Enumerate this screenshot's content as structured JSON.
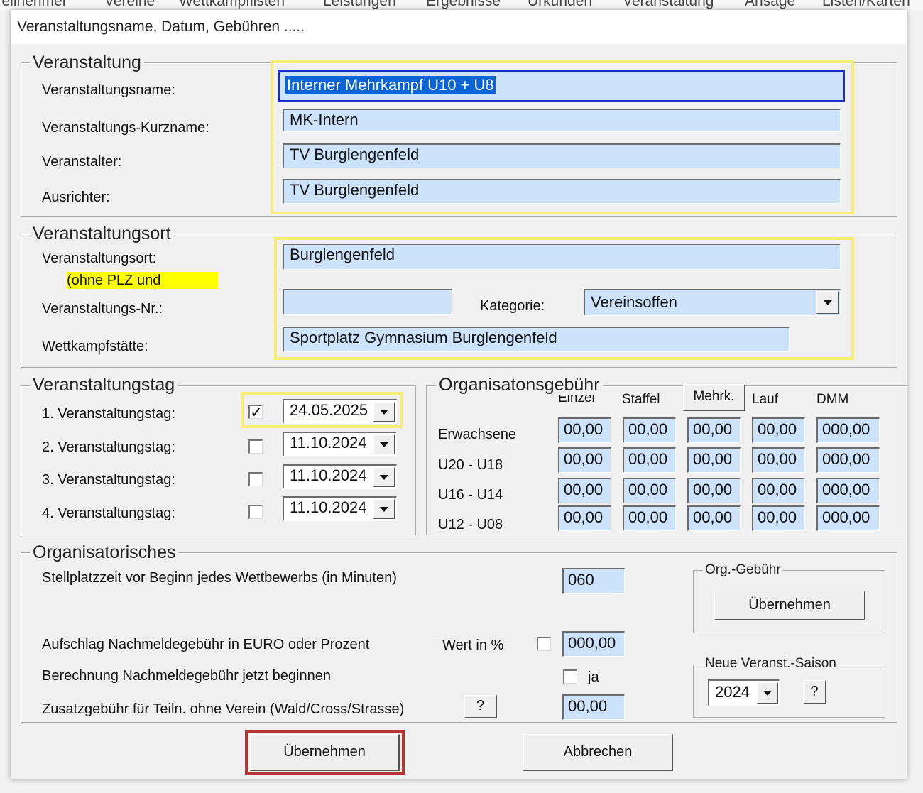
{
  "menubar": {
    "items": [
      "Teilnehmer",
      "Vereine",
      "Wettkampflisten",
      "Leistungen",
      "Ergebnisse",
      "Urkunden",
      "Veranstaltung",
      "Ansage",
      "Listen/Karten"
    ]
  },
  "dialog": {
    "title": "Veranstaltungsname, Datum, Gebühren ....."
  },
  "veranstaltung": {
    "legend": "Veranstaltung",
    "name_label": "Veranstaltungsname:",
    "name_value": "Interner Mehrkampf U10 + U8",
    "kurzname_label": "Veranstaltungs-Kurzname:",
    "kurzname_value": "MK-Intern",
    "veranstalter_label": "Veranstalter:",
    "veranstalter_value": "TV Burglengenfeld",
    "ausrichter_label": "Ausrichter:",
    "ausrichter_value": "TV Burglengenfeld"
  },
  "ort": {
    "legend": "Veranstaltungsort",
    "ort_label": "Veranstaltungsort:",
    "ort_hint": "(ohne PLZ und",
    "ort_value": "Burglengenfeld",
    "nr_label": "Veranstaltungs-Nr.:",
    "nr_value": "",
    "kategorie_label": "Kategorie:",
    "kategorie_value": "Vereinsoffen",
    "staette_label": "Wettkampfstätte:",
    "staette_value": "Sportplatz Gymnasium Burglengenfeld"
  },
  "tag": {
    "legend": "Veranstaltungstag",
    "days": [
      {
        "label": "1. Veranstaltungstag:",
        "checked": true,
        "date": "24.05.2025"
      },
      {
        "label": "2. Veranstaltungstag:",
        "checked": false,
        "date": "11.10.2024"
      },
      {
        "label": "3. Veranstaltungstag:",
        "checked": false,
        "date": "11.10.2024"
      },
      {
        "label": "4. Veranstaltungstag:",
        "checked": false,
        "date": "11.10.2024"
      }
    ]
  },
  "gebuehr": {
    "legend": "Organisatonsgebühr",
    "columns": [
      "Einzel",
      "Staffel",
      "Mehrk.",
      "Lauf",
      "DMM"
    ],
    "rows": [
      {
        "label": "Erwachsene",
        "values": [
          "00,00",
          "00,00",
          "00,00",
          "00,00",
          "000,00"
        ]
      },
      {
        "label": "U20 - U18",
        "values": [
          "00,00",
          "00,00",
          "00,00",
          "00,00",
          "000,00"
        ]
      },
      {
        "label": "U16 - U14",
        "values": [
          "00,00",
          "00,00",
          "00,00",
          "00,00",
          "000,00"
        ]
      },
      {
        "label": "U12 - U08",
        "values": [
          "00,00",
          "00,00",
          "00,00",
          "00,00",
          "000,00"
        ]
      }
    ]
  },
  "org": {
    "legend": "Organisatorisches",
    "stellplatz_label": "Stellplatzzeit vor Beginn jedes Wettbewerbs (in Minuten)",
    "stellplatz_value": "060",
    "aufschlag_label": "Aufschlag Nachmeldegebühr in EURO oder Prozent",
    "wert_label": "Wert in %",
    "aufschlag_value": "000,00",
    "berechnung_label": "Berechnung Nachmeldegebühr jetzt beginnen",
    "ja_label": "ja",
    "zusatz_label": "Zusatzgebühr für Teiln. ohne Verein (Wald/Cross/Strasse)",
    "help": "?",
    "zusatz_value": "00,00",
    "org_gebuehr_legend": "Org.-Gebühr",
    "org_gebuehr_button": "Übernehmen",
    "saison_legend": "Neue Veranst.-Saison",
    "saison_value": "2024",
    "saison_help": "?"
  },
  "footer": {
    "ok": "Übernehmen",
    "cancel": "Abbrechen"
  }
}
